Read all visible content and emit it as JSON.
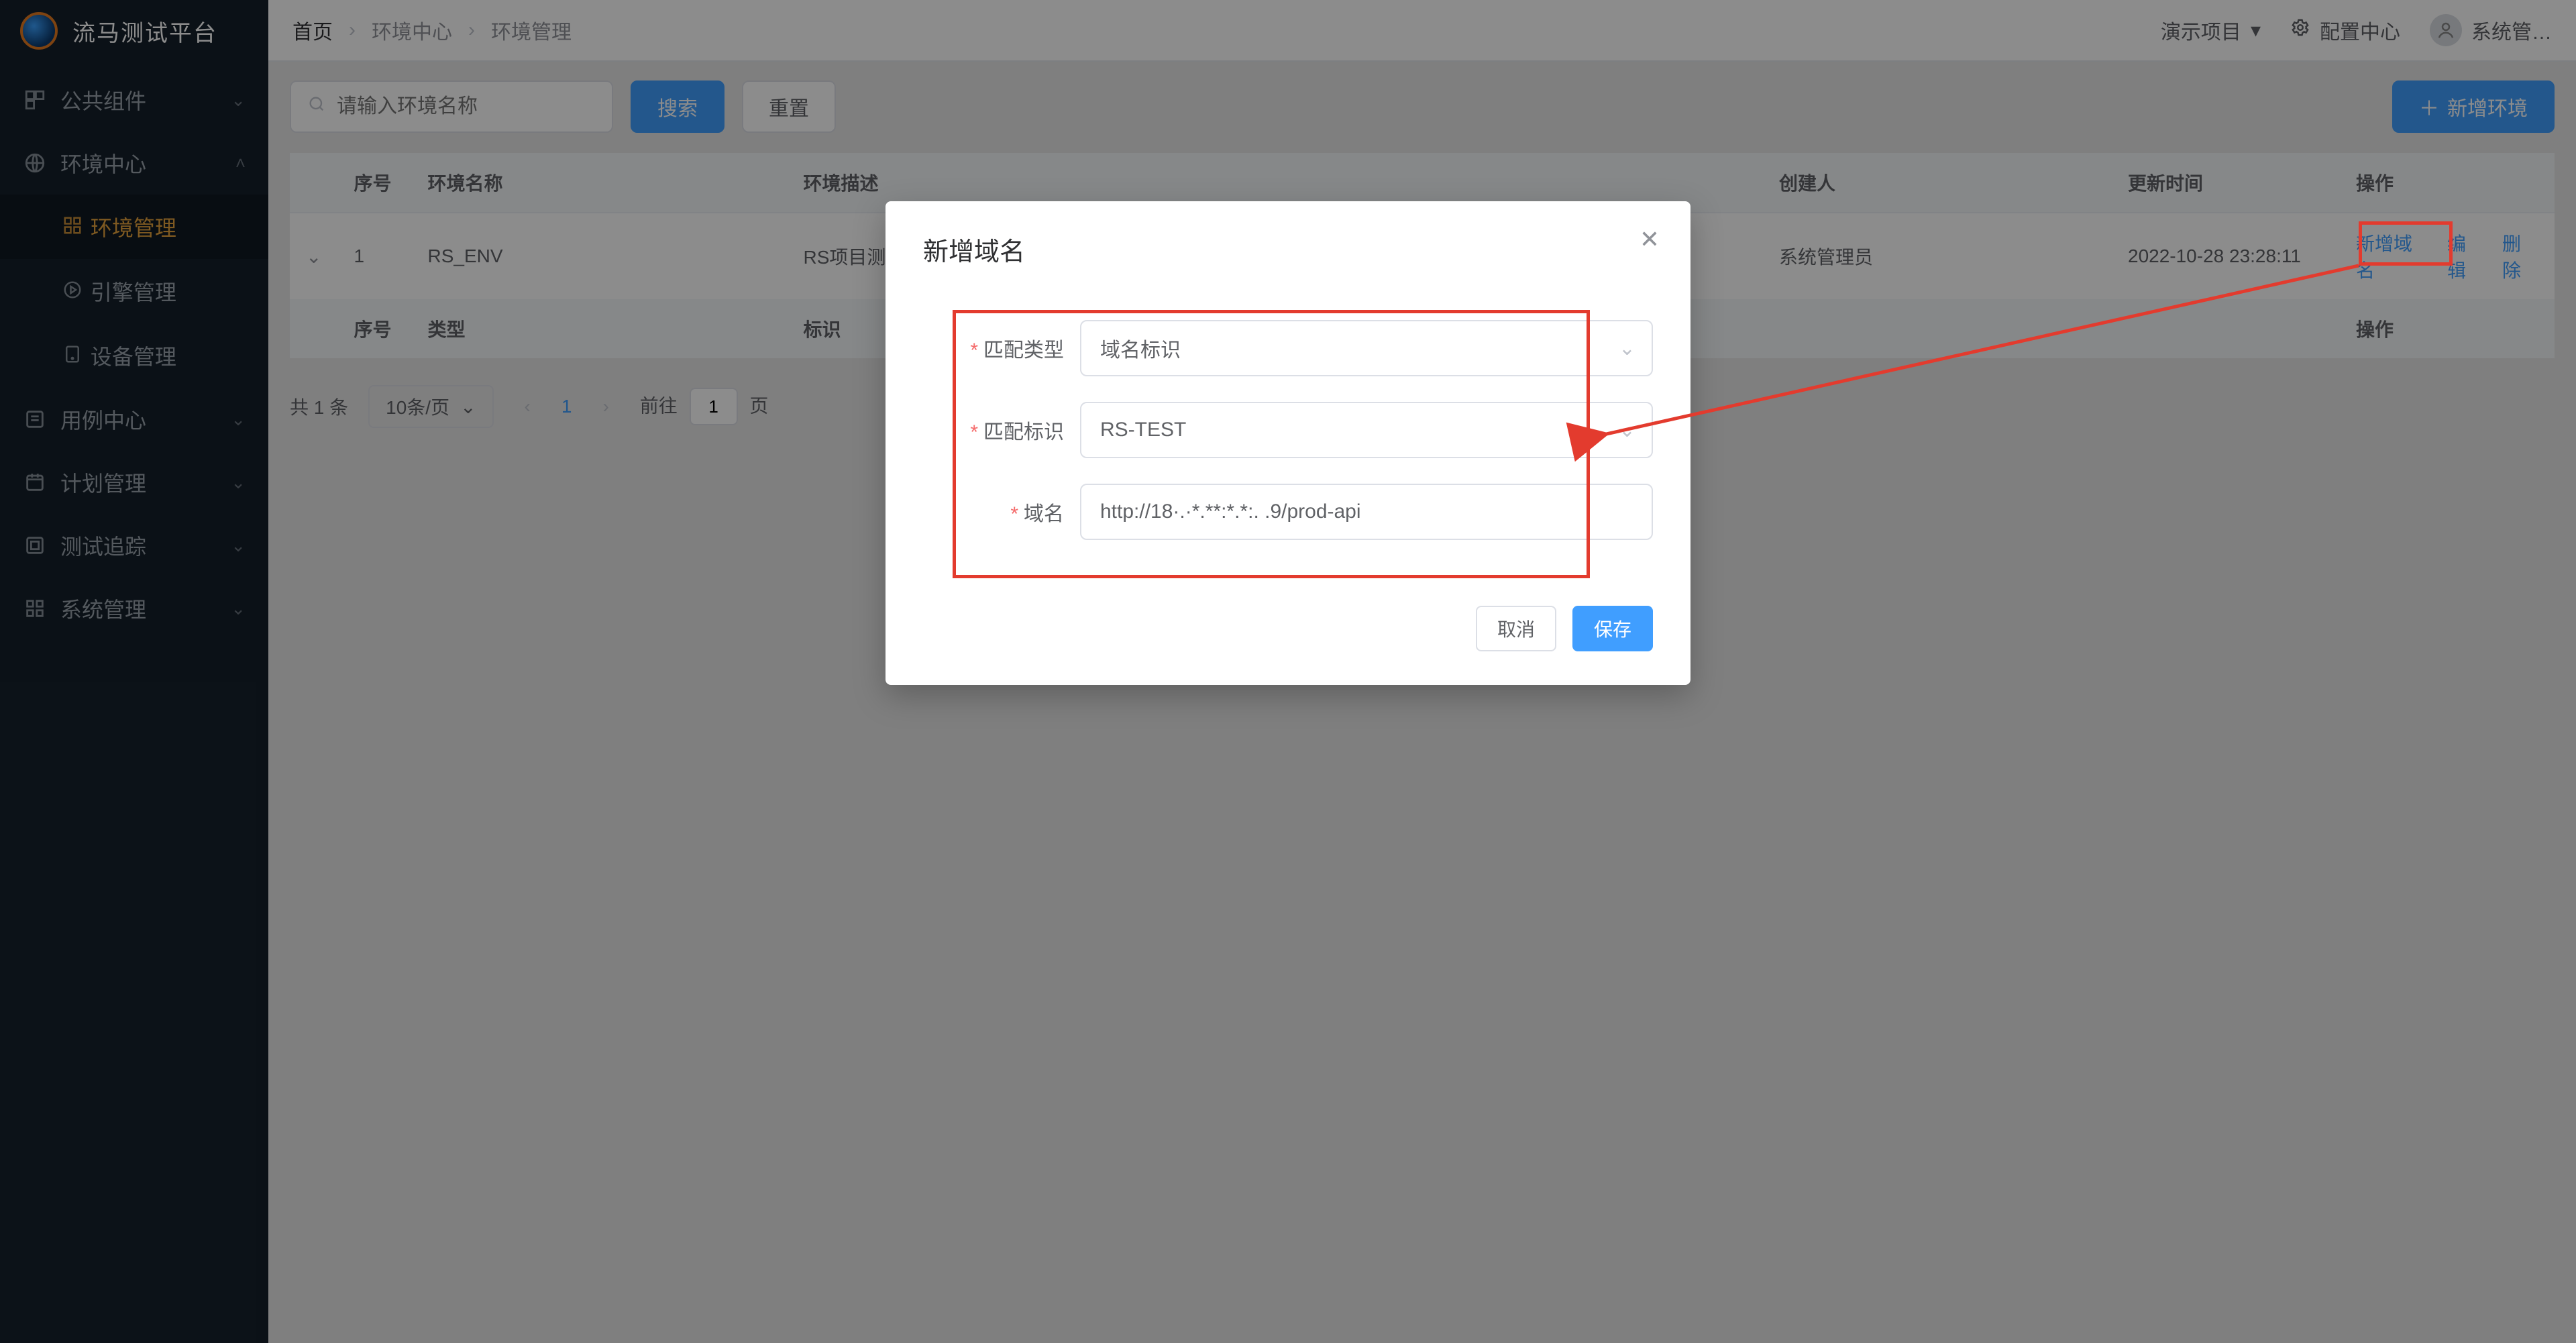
{
  "brand": "流马测试平台",
  "sidebar": {
    "items": [
      {
        "label": "公共组件",
        "icon": "component"
      },
      {
        "label": "环境中心",
        "icon": "globe",
        "open": true,
        "children": [
          {
            "label": "环境管理",
            "icon": "grid",
            "active": true
          },
          {
            "label": "引擎管理",
            "icon": "play"
          },
          {
            "label": "设备管理",
            "icon": "device"
          }
        ]
      },
      {
        "label": "用例中心",
        "icon": "case"
      },
      {
        "label": "计划管理",
        "icon": "calendar"
      },
      {
        "label": "测试追踪",
        "icon": "track"
      },
      {
        "label": "系统管理",
        "icon": "settings"
      }
    ]
  },
  "breadcrumbs": [
    "首页",
    "环境中心",
    "环境管理"
  ],
  "topright": {
    "project": "演示项目",
    "config": "配置中心",
    "user": "系统管…"
  },
  "toolbar": {
    "search_placeholder": "请输入环境名称",
    "search_btn": "搜索",
    "reset_btn": "重置",
    "add_btn": "新增环境"
  },
  "table": {
    "headers": [
      "序号",
      "环境名称",
      "环境描述",
      "创建人",
      "更新时间",
      "操作"
    ],
    "rows": [
      {
        "idx": "1",
        "name": "RS_ENV",
        "desc": "RS项目测",
        "creator": "系统管理员",
        "updated": "2022-10-28 23:28:11",
        "actions": {
          "adddomain": "新增域名",
          "edit": "编辑",
          "delete": "删除"
        }
      }
    ],
    "sub_headers": [
      "序号",
      "类型",
      "标识",
      "操作"
    ]
  },
  "pager": {
    "total_text": "共 1 条",
    "size": "10条/页",
    "current": "1",
    "goto_prefix": "前往",
    "goto_suffix": "页",
    "goto_value": "1"
  },
  "dialog": {
    "title": "新增域名",
    "fields": {
      "match_type": {
        "label": "匹配类型",
        "value": "域名标识"
      },
      "match_key": {
        "label": "匹配标识",
        "value": "RS-TEST"
      },
      "domain": {
        "label": "域名",
        "value": "http://18·.·*.**:*.*:. .9/prod-api"
      }
    },
    "cancel": "取消",
    "save": "保存"
  }
}
